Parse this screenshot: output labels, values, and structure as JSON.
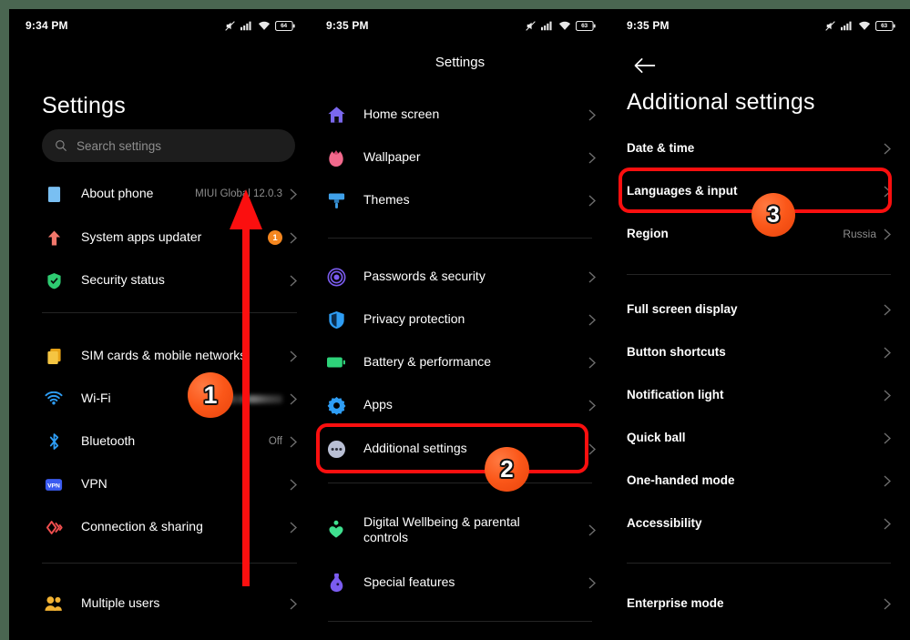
{
  "frame": {
    "border_color": "#4a6651",
    "background": "#000000"
  },
  "accent": {
    "annotation_red": "#fb0f0f",
    "badge_orange": "#f4861f",
    "marker_orange": "#fb5719"
  },
  "panel1": {
    "status": {
      "time": "9:34 PM",
      "battery": "64",
      "icons": [
        "mute-icon",
        "signal-icon",
        "wifi-icon",
        "battery-icon"
      ]
    },
    "title": "Settings",
    "search": {
      "placeholder": "Search settings",
      "value": ""
    },
    "items": [
      {
        "label": "About phone",
        "value": "MIUI Global 12.0.3",
        "icon": "about-phone-icon",
        "badge": ""
      },
      {
        "label": "System apps updater",
        "value": "",
        "icon": "system-updater-icon",
        "badge": "1"
      },
      {
        "label": "Security status",
        "value": "",
        "icon": "security-shield-icon",
        "badge": ""
      },
      {
        "label": "SIM cards & mobile networks",
        "value": "",
        "icon": "sim-card-icon",
        "badge": ""
      },
      {
        "label": "Wi-Fi",
        "value": "",
        "icon": "wifi-icon",
        "badge": ""
      },
      {
        "label": "Bluetooth",
        "value": "Off",
        "icon": "bluetooth-icon",
        "badge": ""
      },
      {
        "label": "VPN",
        "value": "",
        "icon": "vpn-icon",
        "badge": ""
      },
      {
        "label": "Connection & sharing",
        "value": "",
        "icon": "connection-sharing-icon",
        "badge": ""
      },
      {
        "label": "Multiple users",
        "value": "",
        "icon": "multiple-users-icon",
        "badge": ""
      }
    ]
  },
  "panel2": {
    "status": {
      "time": "9:35 PM",
      "battery": "63"
    },
    "title": "Settings",
    "items": [
      {
        "label": "Home screen",
        "icon": "home-screen-icon"
      },
      {
        "label": "Wallpaper",
        "icon": "wallpaper-icon"
      },
      {
        "label": "Themes",
        "icon": "themes-icon"
      },
      {
        "label": "Passwords & security",
        "icon": "passwords-security-icon"
      },
      {
        "label": "Privacy protection",
        "icon": "privacy-protection-icon"
      },
      {
        "label": "Battery & performance",
        "icon": "battery-performance-icon"
      },
      {
        "label": "Apps",
        "icon": "apps-icon"
      },
      {
        "label": "Additional settings",
        "icon": "additional-settings-icon"
      },
      {
        "label": "Digital Wellbeing & parental controls",
        "icon": "digital-wellbeing-icon"
      },
      {
        "label": "Special features",
        "icon": "special-features-icon"
      }
    ]
  },
  "panel3": {
    "status": {
      "time": "9:35 PM",
      "battery": "63"
    },
    "title": "Additional settings",
    "back": "back-arrow",
    "items": [
      {
        "label": "Date & time",
        "value": ""
      },
      {
        "label": "Languages & input",
        "value": ""
      },
      {
        "label": "Region",
        "value": "Russia"
      },
      {
        "label": "Full screen display",
        "value": ""
      },
      {
        "label": "Button shortcuts",
        "value": ""
      },
      {
        "label": "Notification light",
        "value": ""
      },
      {
        "label": "Quick ball",
        "value": ""
      },
      {
        "label": "One-handed mode",
        "value": ""
      },
      {
        "label": "Accessibility",
        "value": ""
      },
      {
        "label": "Enterprise mode",
        "value": ""
      }
    ]
  },
  "annotations": {
    "step1": "1",
    "step2": "2",
    "step3": "3"
  }
}
